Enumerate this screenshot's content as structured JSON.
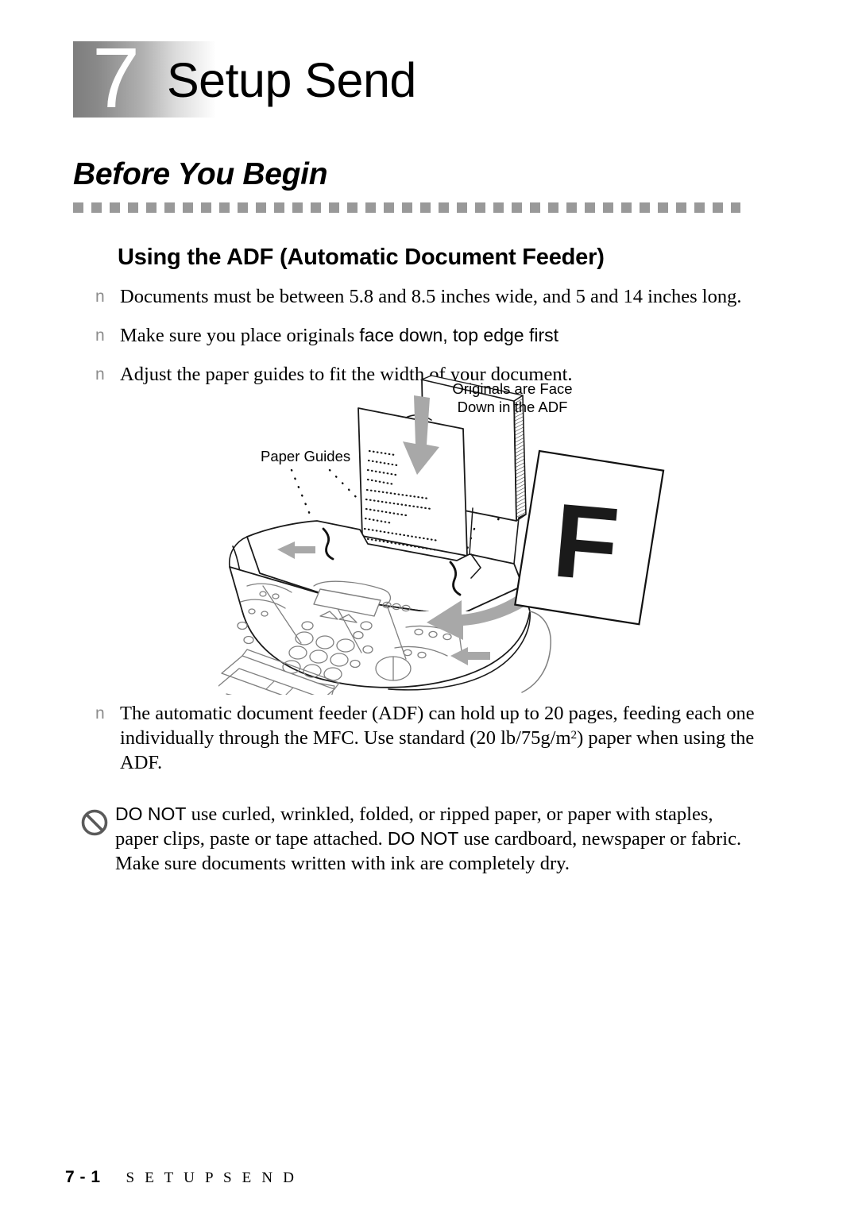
{
  "chapter": {
    "number": "7",
    "title": "Setup Send"
  },
  "section": {
    "heading": "Before You Begin"
  },
  "subsection": {
    "heading": "Using the ADF (Automatic Document Feeder)"
  },
  "bullets_top": [
    {
      "marker": "n",
      "text": "Documents must be between 5.8 and 8.5 inches wide, and 5 and 14 inches long."
    },
    {
      "marker": "n",
      "text_before": "Make sure you place originals ",
      "text_emphasis": "face down, top edge first",
      "text_after": ""
    },
    {
      "marker": "n",
      "text": "Adjust the paper guides to fit the width of your document."
    }
  ],
  "figure": {
    "label_originals": "Originals are Face",
    "label_originals_line2": "Down in the ADF",
    "label_paper_guides": "Paper Guides",
    "sheet_letter": "F"
  },
  "bullets_bottom": [
    {
      "marker": "n",
      "text_part1": "The automatic document feeder (ADF) can hold up to 20 pages, feeding each one individually through the MFC.  Use standard (20 lb/75g/m",
      "superscript": "2",
      "text_part2": ") paper when using the ADF."
    }
  ],
  "note": {
    "icon": "prohibition-icon",
    "donot_1": "DO NOT",
    "text_1": " use curled, wrinkled, folded, or ripped paper, or paper with staples, paper clips, paste or tape attached. ",
    "donot_2": "DO NOT",
    "text_2": " use cardboard, newspaper or fabric.",
    "text_3": "Make sure documents written with ink are completely dry."
  },
  "footer": {
    "page": "7 - 1",
    "title": "S E T U P   S E N D"
  },
  "colors": {
    "rule": "#999999",
    "bullet": "#8c8c8c",
    "note_icon": "#5a5a5a",
    "arrow": "#a8a8a8",
    "band_start": "#7d7d7d",
    "band_end": "#ffffff"
  }
}
